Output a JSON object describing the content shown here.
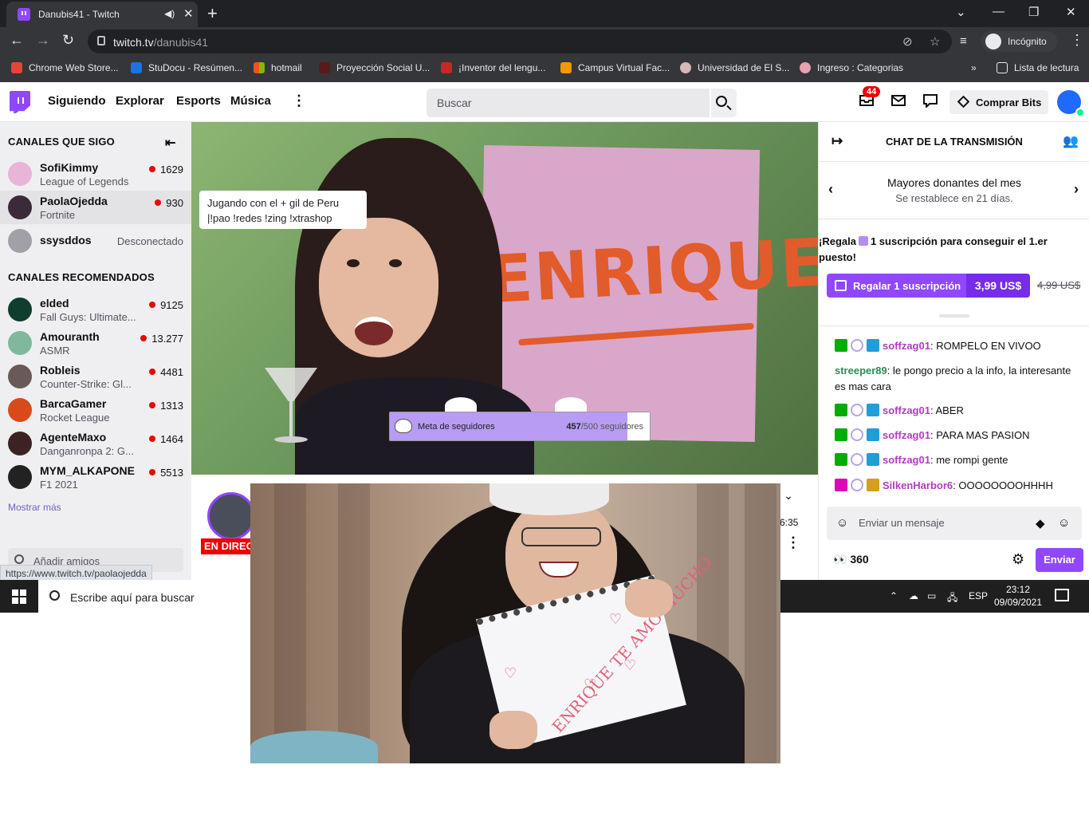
{
  "browser": {
    "tab_title": "Danubis41 - Twitch",
    "url_host": "twitch.tv",
    "url_path": "/danubis41",
    "incognito_label": "Incógnito",
    "bookmarks": [
      "Chrome Web Store...",
      "StuDocu - Resúmen...",
      "hotmail",
      "Proyección Social U...",
      "¡Inventor del lengu...",
      "Campus Virtual Fac...",
      "Universidad de El S...",
      "Ingreso : Categorias"
    ],
    "more_bookmarks": "»",
    "reading_list": "Lista de lectura",
    "hover_url": "https://www.twitch.tv/paolaojedda"
  },
  "nav": {
    "links": [
      "Siguiendo",
      "Explorar",
      "Esports",
      "Música"
    ],
    "search_placeholder": "Buscar",
    "notifications_count": "44",
    "bits_label": "Comprar Bits"
  },
  "sidebar": {
    "followed_heading": "CANALES QUE SIGO",
    "followed": [
      {
        "name": "SofiKimmy",
        "game": "League of Legends",
        "viewers": "1629",
        "color": "#e8b4d8"
      },
      {
        "name": "PaolaOjedda",
        "game": "Fortnite",
        "viewers": "930",
        "color": "#3a2a3a"
      },
      {
        "name": "ssysddos",
        "status": "Desconectado",
        "color": "#a0a0a6"
      }
    ],
    "recommended_heading": "CANALES RECOMENDADOS",
    "recommended": [
      {
        "name": "elded",
        "game": "Fall Guys: Ultimate...",
        "viewers": "9125",
        "color": "#0f3d2e"
      },
      {
        "name": "Amouranth",
        "game": "ASMR",
        "viewers": "13.277",
        "color": "#7fb89a"
      },
      {
        "name": "Robleis",
        "game": "Counter-Strike: Gl...",
        "viewers": "4481",
        "color": "#6a5a55"
      },
      {
        "name": "BarcaGamer",
        "game": "Rocket League",
        "viewers": "1313",
        "color": "#d94a1a"
      },
      {
        "name": "AgenteMaxo",
        "game": "Danganronpa 2: G...",
        "viewers": "1464",
        "color": "#3c2222"
      },
      {
        "name": "MYM_ALKAPONE",
        "game": "F1 2021",
        "viewers": "5513",
        "color": "#222222"
      }
    ],
    "show_more": "Mostrar más",
    "add_friends_placeholder": "Añadir amigos"
  },
  "video": {
    "overlay_note_line1": "Jugando con el + gil de Peru",
    "overlay_note_line2": "|!pao !redes !zing !xtrashop",
    "poster_text": "ENRIQUE",
    "goal_label": "Meta de seguidores",
    "goal_current": "457",
    "goal_total": "/500 seguidores",
    "goal_fraction": 0.914,
    "live_badge": "EN DIREC",
    "uptime": "6:35"
  },
  "chat": {
    "title": "CHAT DE LA TRANSMISIÓN",
    "leaderboard_title": "Mayores donantes del mes",
    "leaderboard_sub": "Se restablece en 21 días.",
    "gift_prefix": "¡Regala",
    "gift_suffix": "1 suscripción para conseguir el 1.er puesto!",
    "gift_button": "Regalar 1 suscripción",
    "gift_price": "3,99 US$",
    "gift_old_price": "4,99 US$",
    "messages": [
      {
        "user": "soffzag01",
        "color": "#b13ac0",
        "badges": [
          "g",
          "h",
          "c"
        ],
        "text": ": ROMPELO EN VIVOO"
      },
      {
        "user": "streeper89",
        "color": "#2e8b57",
        "badges": [],
        "text": ": le pongo precio a la info, la interesante es mas cara"
      },
      {
        "user": "soffzag01",
        "color": "#b13ac0",
        "badges": [
          "g",
          "h",
          "c"
        ],
        "text": ": ABER"
      },
      {
        "user": "soffzag01",
        "color": "#b13ac0",
        "badges": [
          "g",
          "h",
          "c"
        ],
        "text": ": PARA MAS PASION"
      },
      {
        "user": "soffzag01",
        "color": "#b13ac0",
        "badges": [
          "g",
          "h",
          "c"
        ],
        "text": ": me rompi gente"
      },
      {
        "user": "SilkenHarbor6",
        "color": "#b13ac0",
        "badges": [
          "p",
          "h",
          "y"
        ],
        "text": ": OOOOOOOOHHHH"
      }
    ],
    "input_placeholder": "Enviar un mensaje",
    "points": "360",
    "send_label": "Enviar"
  },
  "taskbar": {
    "search_placeholder": "Escribe aquí para buscar",
    "lang": "ESP",
    "time": "23:12",
    "date": "09/09/2021"
  },
  "photo": {
    "notebook_text": "ENRIQUE TE AMO MUCHO"
  }
}
